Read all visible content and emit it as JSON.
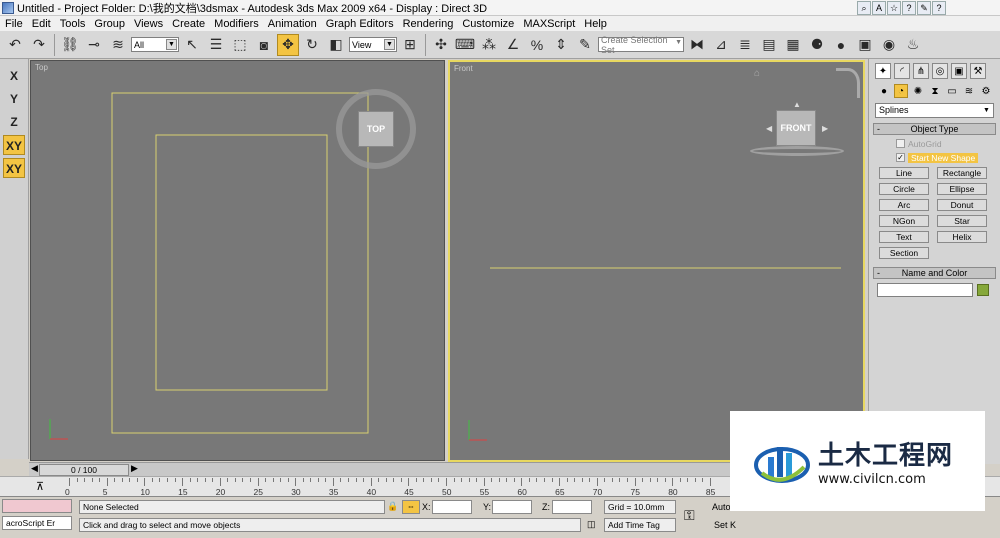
{
  "window": {
    "title": "Untitled     - Project Folder: D:\\我的文档\\3dsmax      - Autodesk 3ds Max  2009 x64       - Display : Direct 3D"
  },
  "menu": [
    "File",
    "Edit",
    "Tools",
    "Group",
    "Views",
    "Create",
    "Modifiers",
    "Animation",
    "Graph Editors",
    "Rendering",
    "Customize",
    "MAXScript",
    "Help"
  ],
  "toolbar": {
    "filter_select": "All",
    "coord_select": "View",
    "selection_set_placeholder": "Create Selection Set"
  },
  "axis_constraints": [
    "X",
    "Y",
    "Z",
    "XY",
    "XY"
  ],
  "viewports": {
    "top": {
      "label": "Top",
      "cube_label": "TOP"
    },
    "front": {
      "label": "Front",
      "cube_label": "FRONT"
    }
  },
  "command_panel": {
    "category": "Splines",
    "object_type": {
      "title": "Object Type",
      "autogrid": "AutoGrid",
      "start_new_shape": "Start New Shape",
      "buttons": [
        "Line",
        "Rectangle",
        "Circle",
        "Ellipse",
        "Arc",
        "Donut",
        "NGon",
        "Star",
        "Text",
        "Helix",
        "Section"
      ]
    },
    "name_and_color": {
      "title": "Name and Color",
      "name_value": "",
      "color": "#86a83a"
    }
  },
  "time_slider": {
    "position": "0 / 100"
  },
  "trackbar": {
    "ticks": [
      "0",
      "5",
      "10",
      "15",
      "20",
      "25",
      "30",
      "35",
      "40",
      "45",
      "50",
      "55",
      "60",
      "65",
      "70",
      "75",
      "80",
      "85"
    ]
  },
  "status": {
    "maxscript_listener": "acroScript Er",
    "selection": "None Selected",
    "prompt": "Click and drag to select and move objects",
    "x_label": "X:",
    "y_label": "Y:",
    "z_label": "Z:",
    "x_value": "",
    "y_value": "",
    "z_value": "",
    "grid": "Grid = 10.0mm",
    "add_time_tag": "Add Time Tag",
    "auto_key": "Auto",
    "set_key": "Set K"
  },
  "watermark": {
    "brand": "土木工程网",
    "url": "www.civilcn.com"
  }
}
